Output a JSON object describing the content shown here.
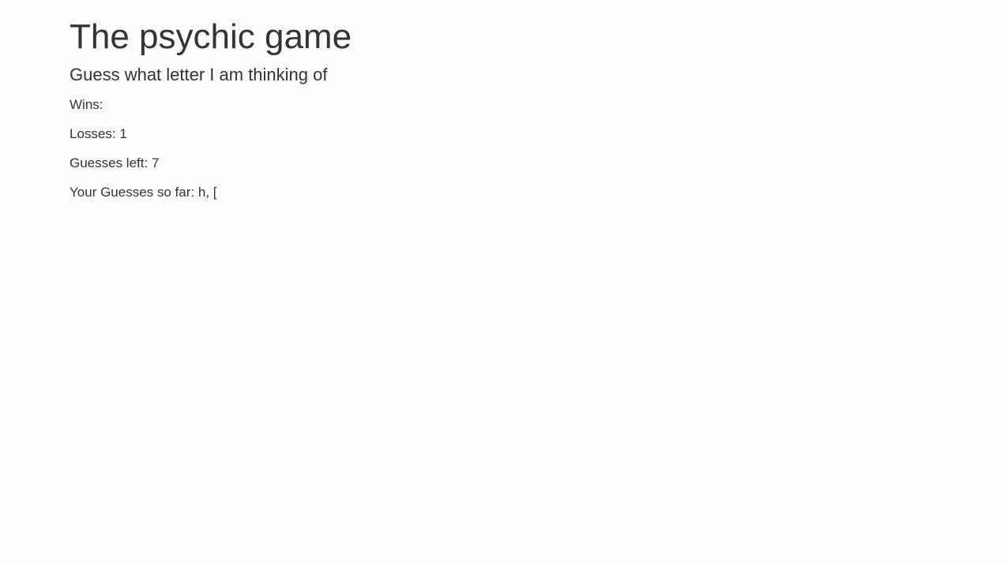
{
  "page": {
    "title": "The psychic game",
    "subtitle": "Guess what letter I am thinking of"
  },
  "stats": {
    "wins_label": "Wins:",
    "wins_value": "",
    "losses_label": "Losses:",
    "losses_value": "1",
    "guesses_left_label": "Guesses left:",
    "guesses_left_value": "7",
    "guesses_so_far_label": "Your Guesses so far:",
    "guesses_so_far_value": "h, ["
  }
}
